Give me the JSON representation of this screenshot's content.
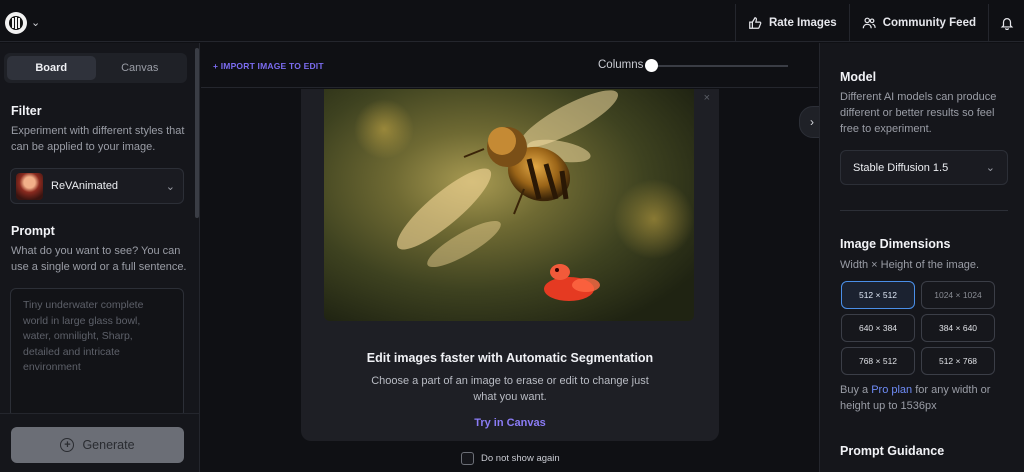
{
  "header": {
    "rate_images": "Rate Images",
    "community_feed": "Community Feed"
  },
  "left": {
    "tabs": [
      {
        "label": "Board",
        "active": true
      },
      {
        "label": "Canvas",
        "active": false
      }
    ],
    "filter": {
      "title": "Filter",
      "description": "Experiment with different styles that can be applied to your image.",
      "selected_model": "ReVAnimated"
    },
    "prompt": {
      "title": "Prompt",
      "description": "What do you want to see? You can use a single word or a full sentence.",
      "placeholder": "Tiny underwater complete world in large glass bowl, water, omnilight, Sharp, detailed and intricate environment"
    },
    "generate_label": "Generate"
  },
  "center": {
    "import_label": "+ IMPORT IMAGE TO EDIT",
    "columns_label": "Columns",
    "columns_slider_value": 0,
    "modal": {
      "title": "Edit images faster with Automatic Segmentation",
      "description": "Choose a part of an image to erase or edit to change just what you want.",
      "link": "Try in Canvas",
      "close_glyph": "×"
    },
    "dont_show_again": "Do not show again"
  },
  "right": {
    "model": {
      "title": "Model",
      "description": "Different AI models can produce different or better results so feel free to experiment.",
      "selected": "Stable Diffusion 1.5"
    },
    "dimensions": {
      "title": "Image Dimensions",
      "description": "Width × Height of the image.",
      "options": [
        {
          "label": "512 × 512",
          "selected": true,
          "muted": false
        },
        {
          "label": "1024 × 1024",
          "selected": false,
          "muted": true
        },
        {
          "label": "640 × 384",
          "selected": false,
          "muted": false
        },
        {
          "label": "384 × 640",
          "selected": false,
          "muted": false
        },
        {
          "label": "768 × 512",
          "selected": false,
          "muted": false
        },
        {
          "label": "512 × 768",
          "selected": false,
          "muted": false
        }
      ],
      "pro_prefix": "Buy a ",
      "pro_link": "Pro plan",
      "pro_suffix": " for any width or height up to 1536px"
    },
    "guidance": {
      "title": "Prompt Guidance"
    }
  },
  "colors": {
    "accent_purple": "#8b7cf6",
    "selected_blue": "#4a8fe8",
    "background": "#0f1014",
    "panel": "#15161b"
  }
}
